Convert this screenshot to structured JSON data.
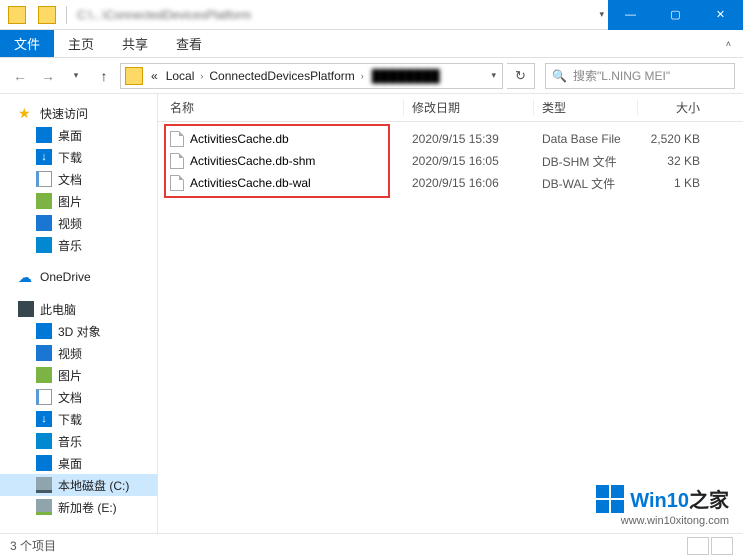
{
  "titlebar": {
    "path_hint": "C:\\...\\ConnectedDevicesPlatform"
  },
  "ribbon": {
    "file": "文件",
    "tabs": [
      "主页",
      "共享",
      "查看"
    ]
  },
  "address": {
    "prefix": "«",
    "segments": [
      "Local",
      "ConnectedDevicesPlatform"
    ],
    "trailing_blur": "████████"
  },
  "search": {
    "placeholder": "搜索\"L.NING MEI\""
  },
  "columns": {
    "name": "名称",
    "date": "修改日期",
    "type": "类型",
    "size": "大小"
  },
  "files": [
    {
      "name": "ActivitiesCache.db",
      "date": "2020/9/15 15:39",
      "type": "Data Base File",
      "size": "2,520 KB"
    },
    {
      "name": "ActivitiesCache.db-shm",
      "date": "2020/9/15 16:05",
      "type": "DB-SHM 文件",
      "size": "32 KB"
    },
    {
      "name": "ActivitiesCache.db-wal",
      "date": "2020/9/15 16:06",
      "type": "DB-WAL 文件",
      "size": "1 KB"
    }
  ],
  "sidebar": {
    "quick": {
      "label": "快速访问",
      "items": [
        "桌面",
        "下载",
        "文档",
        "图片",
        "视频",
        "音乐"
      ]
    },
    "onedrive": "OneDrive",
    "pc": {
      "label": "此电脑",
      "items": [
        "3D 对象",
        "视频",
        "图片",
        "文档",
        "下载",
        "音乐",
        "桌面",
        "本地磁盘 (C:)",
        "新加卷 (E:)"
      ]
    }
  },
  "status": {
    "count": "3 个项目"
  },
  "watermark": {
    "brand_a": "Win10",
    "brand_b": "之家",
    "url": "www.win10xitong.com"
  }
}
